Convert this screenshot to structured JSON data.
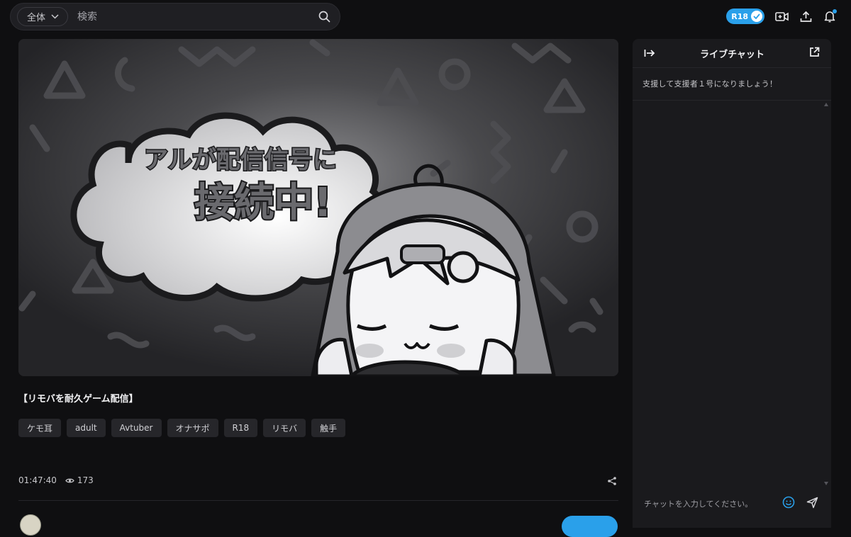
{
  "search": {
    "scope_label": "全体",
    "placeholder": "検索"
  },
  "header": {
    "r18_badge": "R18"
  },
  "icons": {
    "search": "search-icon",
    "chevron": "chevron-down-icon",
    "check": "check-icon",
    "go_live": "video-plus-icon",
    "upload": "upload-icon",
    "notifications": "bell-icon",
    "views": "eye-icon",
    "share": "share-icon",
    "collapse": "arrow-right-bar-icon",
    "popout": "external-link-icon",
    "emoji": "smile-icon",
    "send": "send-icon"
  },
  "player": {
    "thumbnail_text_line1": "アルが配信信号に",
    "thumbnail_text_line2": "接続中!"
  },
  "stream": {
    "title": "【リモバを耐久ゲーム配信】",
    "tags": [
      "ケモ耳",
      "adult",
      "Avtuber",
      "オナサポ",
      "R18",
      "リモバ",
      "触手"
    ],
    "duration": "01:47:40",
    "views": "173"
  },
  "chat": {
    "title": "ライブチャット",
    "notice": "支援して支援者１号になりましょう！",
    "input_placeholder": "チャットを入力してください。"
  },
  "colors": {
    "accent": "#2aa0ea",
    "background": "#0f0f11",
    "panel": "#1a1a1d"
  }
}
